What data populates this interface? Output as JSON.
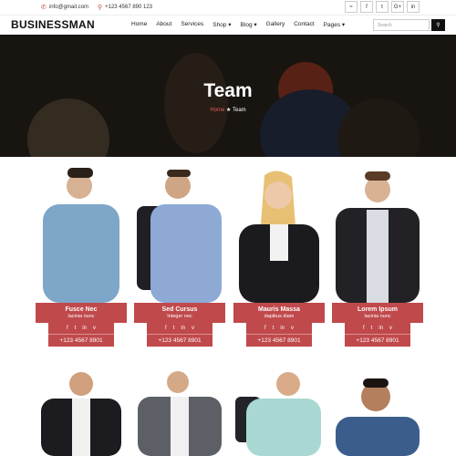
{
  "topbar": {
    "email": "info@gmail.com",
    "phone": "+123 4567 890 123",
    "socials": [
      "rss-icon",
      "facebook-icon",
      "twitter-icon",
      "google-plus-icon",
      "linkedin-icon"
    ]
  },
  "nav": {
    "logo": "BUSINESSMAN",
    "items": [
      "Home",
      "About",
      "Services",
      "Shop",
      "Blog",
      "Gallery",
      "Contact",
      "Pages"
    ],
    "search_placeholder": "Search"
  },
  "hero": {
    "title": "Team",
    "crumb_home": "Home",
    "crumb_current": "Team"
  },
  "team": [
    {
      "name": "Fusce Nec",
      "role": "lacinia nunc",
      "phone": "+123 4567 8901"
    },
    {
      "name": "Sed Cursus",
      "role": "Integer nec",
      "phone": "+123 4567 8901"
    },
    {
      "name": "Mauris Massa",
      "role": "dapibus diam",
      "phone": "+123 4567 8901"
    },
    {
      "name": "Lorem Ipsum",
      "role": "lacinia nunc",
      "phone": "+123 4567 8901"
    }
  ],
  "colors": {
    "accent": "#c0494b"
  }
}
